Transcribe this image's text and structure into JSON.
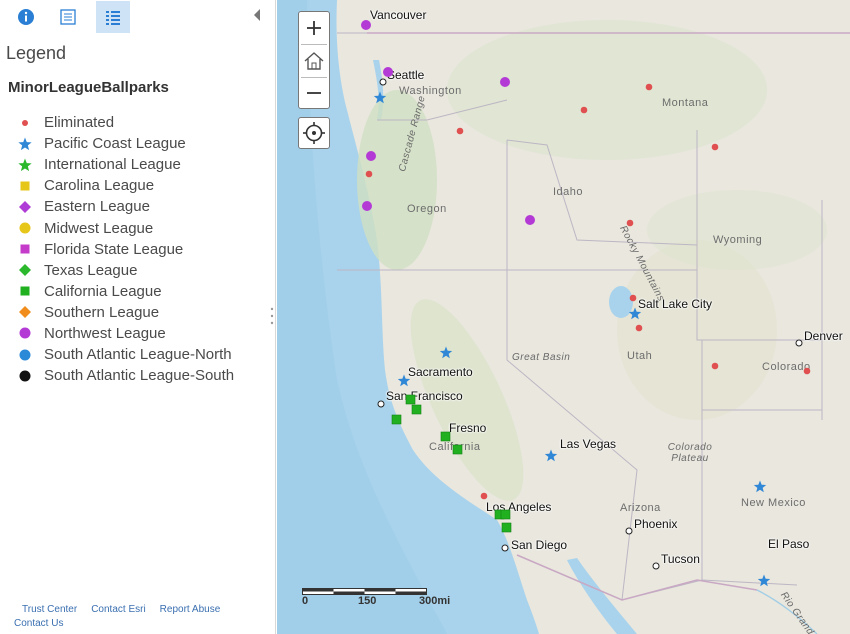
{
  "sidebar": {
    "tabs": [
      {
        "name": "about-tab",
        "icon": "info-icon"
      },
      {
        "name": "layers-tab",
        "icon": "layers-icon"
      },
      {
        "name": "legend-tab",
        "icon": "list-icon",
        "active": true
      }
    ],
    "legend_title": "Legend",
    "layer_title": "MinorLeagueBallparks",
    "legend_items": [
      {
        "label": "Eliminated",
        "shape": "small-circle",
        "color": "#e05050"
      },
      {
        "label": "Pacific Coast League",
        "shape": "star",
        "color": "#2f87d6"
      },
      {
        "label": "International League",
        "shape": "star",
        "color": "#2cb82c"
      },
      {
        "label": "Carolina League",
        "shape": "square",
        "color": "#e6c619"
      },
      {
        "label": "Eastern League",
        "shape": "diamond",
        "color": "#b03cd8"
      },
      {
        "label": "Midwest League",
        "shape": "circle",
        "color": "#e6c619"
      },
      {
        "label": "Florida State League",
        "shape": "square",
        "color": "#c43cc9"
      },
      {
        "label": "Texas League",
        "shape": "diamond",
        "color": "#2cb82c"
      },
      {
        "label": "California League",
        "shape": "square",
        "color": "#20b020"
      },
      {
        "label": "Southern League",
        "shape": "diamond",
        "color": "#f08d1c"
      },
      {
        "label": "Northwest League",
        "shape": "circle",
        "color": "#b43ad6"
      },
      {
        "label": "South Atlantic League-North",
        "shape": "circle",
        "color": "#2a8ad8"
      },
      {
        "label": "South Atlantic League-South",
        "shape": "circle",
        "color": "#111111"
      }
    ],
    "footer": [
      "Trust Center",
      "Contact Esri",
      "Report Abuse",
      "Contact Us"
    ]
  },
  "map": {
    "zoom_in": "+",
    "zoom_out": "−",
    "scale_labels": [
      "0",
      "150",
      "300mi"
    ],
    "cities": [
      "Vancouver",
      "Seattle",
      "Sacramento",
      "San Francisco",
      "Fresno",
      "Las Vegas",
      "Los Angeles",
      "San Diego",
      "Phoenix",
      "Tucson",
      "El Paso",
      "Salt Lake City",
      "Denver"
    ],
    "regions": [
      "Washington",
      "Oregon",
      "Idaho",
      "Montana",
      "Wyoming",
      "Utah",
      "Colorado",
      "California",
      "Arizona",
      "New Mexico",
      "Rocky Mountains",
      "Cascade Range",
      "Great Basin",
      "Colorado Plateau",
      "Rio Grande"
    ]
  }
}
